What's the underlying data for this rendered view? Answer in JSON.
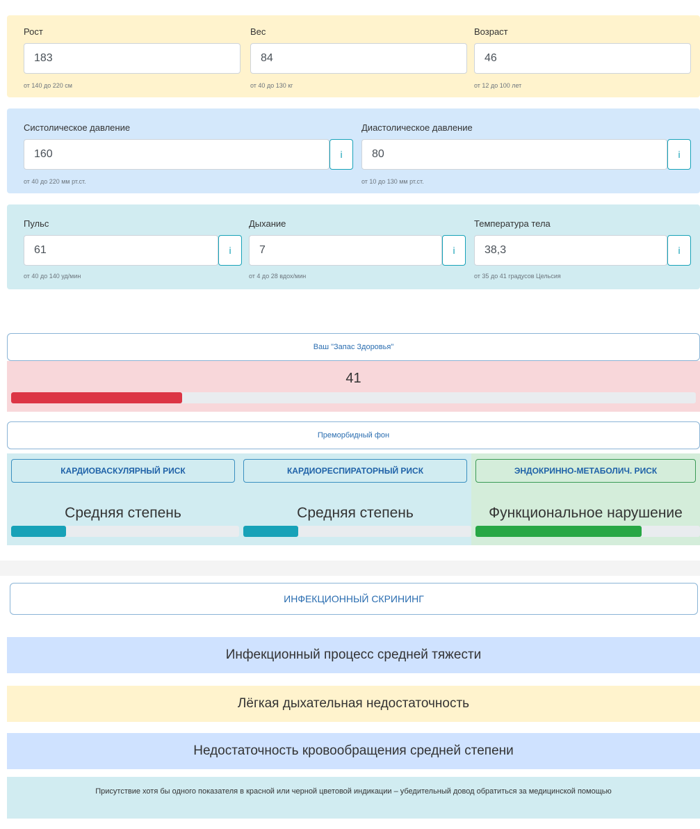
{
  "anthropometry": {
    "height": {
      "label": "Рост",
      "value": "183",
      "hint": "от 140 до 220 см"
    },
    "weight": {
      "label": "Вес",
      "value": "84",
      "hint": "от 40 до 130 кг"
    },
    "age": {
      "label": "Возраст",
      "value": "46",
      "hint": "от 12 до 100 лет"
    }
  },
  "pressure": {
    "systolic": {
      "label": "Систолическое давление",
      "value": "160",
      "hint": "от 40 до 220 мм рт.ст.",
      "info": "i"
    },
    "diastolic": {
      "label": "Диастолическое давление",
      "value": "80",
      "hint": "от 10 до 130 мм рт.ст.",
      "info": "i"
    }
  },
  "vitals": {
    "pulse": {
      "label": "Пульс",
      "value": "61",
      "hint": "от 40 до 140 уд/мин",
      "info": "i"
    },
    "breathing": {
      "label": "Дыхание",
      "value": "7",
      "hint": "от 4 до 28 вдох/мин",
      "info": "i"
    },
    "temperature": {
      "label": "Температура тела",
      "value": "38,3",
      "hint": "от 35 до 41 градусов Цельсия",
      "info": "i"
    }
  },
  "health_reserve": {
    "button_label": "Ваш \"Запас Здоровья\"",
    "value": "41",
    "progress_percent": 25,
    "color": "#dc3545"
  },
  "premorbid": {
    "button_label": "Преморбидный фон",
    "risks": [
      {
        "title": "КАРДИОВАСКУЛЯРНЫЙ РИСК",
        "result": "Средняя степень",
        "progress_percent": 24,
        "color": "#17a2b8"
      },
      {
        "title": "КАРДИОРЕСПИРАТОРНЫЙ РИСК",
        "result": "Средняя степень",
        "progress_percent": 24,
        "color": "#17a2b8"
      },
      {
        "title": "ЭНДОКРИННО-МЕТАБОЛИЧ. РИСК",
        "result": "Функциональное нарушение",
        "progress_percent": 74,
        "color": "#28a745"
      }
    ]
  },
  "infection": {
    "button_label": "ИНФЕКЦИОННЫЙ СКРИНИНГ",
    "results": [
      {
        "text": "Инфекционный процесс средней тяжести",
        "color": "#cfe2ff"
      },
      {
        "text": "Лёгкая дыхательная недостаточность",
        "color": "#fff3cd"
      },
      {
        "text": "Недостаточность кровообращения средней степени",
        "color": "#cfe2ff"
      }
    ],
    "note": "Присутствие хотя бы одного показателя в красной или черной цветовой индикации – убедительный довод обратиться за медицинской помощью"
  }
}
